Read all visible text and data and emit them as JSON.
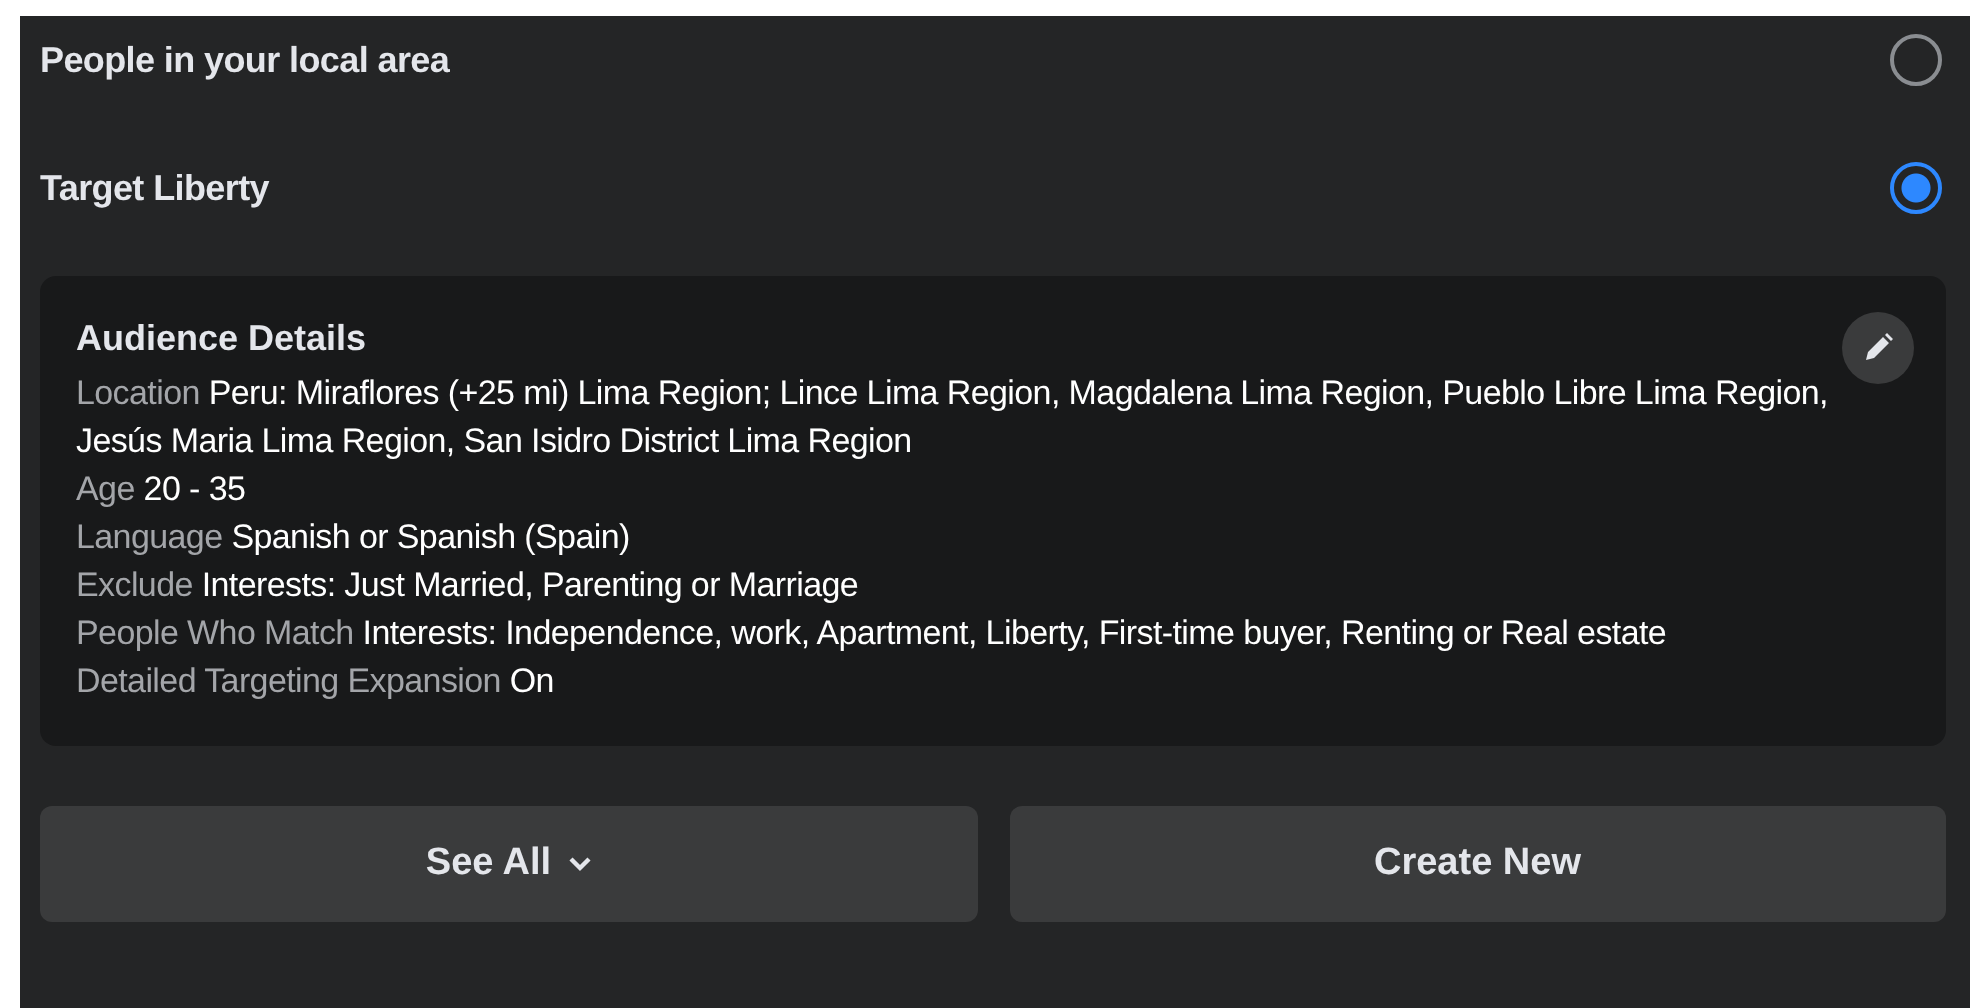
{
  "audiences": [
    {
      "name": "People in your local area",
      "selected": false
    },
    {
      "name": "Target Liberty",
      "selected": true
    }
  ],
  "details": {
    "title": "Audience Details",
    "rows": [
      {
        "label": "Location",
        "value": "Peru: Miraflores (+25 mi) Lima Region; Lince Lima Region, Magdalena Lima Region, Pueblo Libre Lima Region, Jesús Maria Lima Region, San Isidro District Lima Region"
      },
      {
        "label": "Age",
        "value": "20 - 35"
      },
      {
        "label": "Language",
        "value": "Spanish or Spanish (Spain)"
      },
      {
        "label": "Exclude",
        "value": "Interests: Just Married, Parenting or Marriage"
      },
      {
        "label": "People Who Match",
        "value": "Interests: Independence, work, Apartment, Liberty, First-time buyer, Renting or Real estate"
      },
      {
        "label": "Detailed Targeting Expansion",
        "value": "On"
      }
    ]
  },
  "buttons": [
    {
      "label": "See All",
      "kind": "dropdown"
    },
    {
      "label": "Create New",
      "kind": "plain"
    }
  ]
}
